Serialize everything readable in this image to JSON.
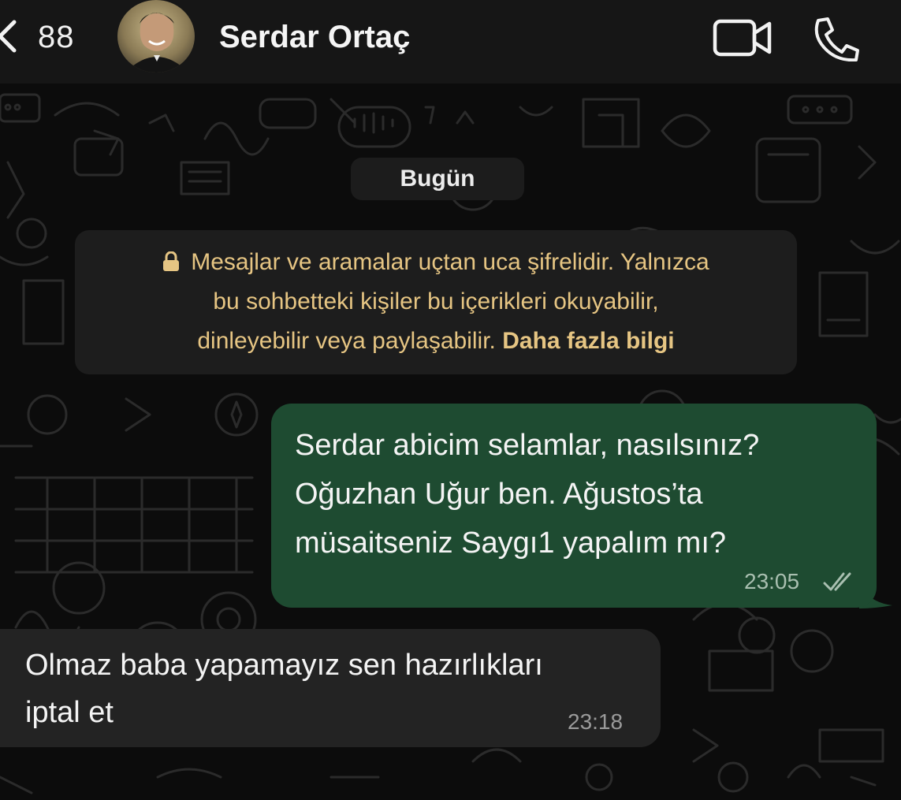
{
  "header": {
    "unread_count": "88",
    "contact_name": "Serdar Ortaç",
    "back_icon": "chevron-left-icon",
    "video_icon": "video-camera-icon",
    "call_icon": "phone-icon"
  },
  "chat": {
    "date_label": "Bugün",
    "encryption_notice": {
      "lines": [
        "Mesajlar ve aramalar uçtan uca şifrelidir. Yalnızca",
        "bu sohbetteki kişiler bu içerikleri okuyabilir,",
        "dinleyebilir veya paylaşabilir."
      ],
      "link_text": "Daha fazla bilgi",
      "icon": "lock-icon"
    },
    "messages": [
      {
        "direction": "outgoing",
        "lines": [
          "Serdar abicim selamlar, nasılsınız?",
          "Oğuzhan Uğur ben. Ağustos’ta",
          "müsaitseniz Saygı1 yapalım mı?"
        ],
        "time": "23:05",
        "status": "read"
      },
      {
        "direction": "incoming",
        "lines": [
          "Olmaz baba yapamayız sen hazırlıkları",
          "iptal et"
        ],
        "time": "23:18"
      }
    ]
  },
  "colors": {
    "header_bg": "#161616",
    "outgoing_bubble": "#1e4b31",
    "incoming_bubble": "#232323",
    "notice_text": "#e6c583"
  }
}
